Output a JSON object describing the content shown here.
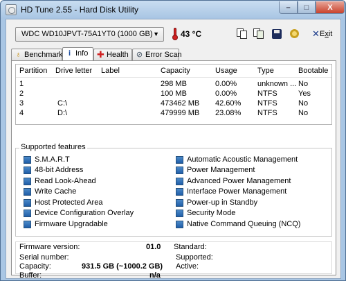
{
  "window": {
    "title": "HD Tune 2.55 - Hard Disk Utility",
    "controls": {
      "minimize": "–",
      "maximize": "□",
      "close": "X"
    }
  },
  "toolbar": {
    "drive": "WDC WD10JPVT-75A1YT0 (1000 GB)",
    "temperature": "43 °C",
    "exit_prefix": "E",
    "exit_underlined": "x",
    "exit_suffix": "it",
    "exit_glyph": "✕"
  },
  "tabs": [
    {
      "label": "Benchmark",
      "icon": "gauge-icon",
      "active": false
    },
    {
      "label": "Info",
      "icon": "info-icon",
      "active": true
    },
    {
      "label": "Health",
      "icon": "health-cross-icon",
      "active": false
    },
    {
      "label": "Error Scan",
      "icon": "error-scan-icon",
      "active": false
    }
  ],
  "partitions": {
    "columns": [
      "Partition",
      "Drive letter",
      "Label",
      "Capacity",
      "Usage",
      "Type",
      "Bootable"
    ],
    "rows": [
      {
        "partition": "1",
        "drive_letter": "",
        "label": "",
        "capacity": "298 MB",
        "usage": "0.00%",
        "type": "unknown ...",
        "bootable": "No"
      },
      {
        "partition": "2",
        "drive_letter": "",
        "label": "",
        "capacity": "100 MB",
        "usage": "0.00%",
        "type": "NTFS",
        "bootable": "Yes"
      },
      {
        "partition": "3",
        "drive_letter": "C:\\",
        "label": "",
        "capacity": "473462 MB",
        "usage": "42.60%",
        "type": "NTFS",
        "bootable": "No"
      },
      {
        "partition": "4",
        "drive_letter": "D:\\",
        "label": "",
        "capacity": "479999 MB",
        "usage": "23.08%",
        "type": "NTFS",
        "bootable": "No"
      }
    ]
  },
  "features": {
    "title": "Supported features",
    "left": [
      "S.M.A.R.T",
      "48-bit Address",
      "Read Look-Ahead",
      "Write Cache",
      "Host Protected Area",
      "Device Configuration Overlay",
      "Firmware Upgradable"
    ],
    "right": [
      "Automatic Acoustic Management",
      "Power Management",
      "Advanced Power Management",
      "Interface Power Management",
      "Power-up in Standby",
      "Security Mode",
      "Native Command Queuing (NCQ)"
    ]
  },
  "info": {
    "firmware_label": "Firmware version:",
    "firmware_value": "01.0",
    "serial_label": "Serial number:",
    "serial_value": "",
    "capacity_label": "Capacity:",
    "capacity_value": "931.5 GB (~1000.2 GB)",
    "buffer_label": "Buffer:",
    "buffer_value": "n/a",
    "standard_label": "Standard:",
    "supported_label": "Supported:",
    "active_label": "Active:"
  }
}
